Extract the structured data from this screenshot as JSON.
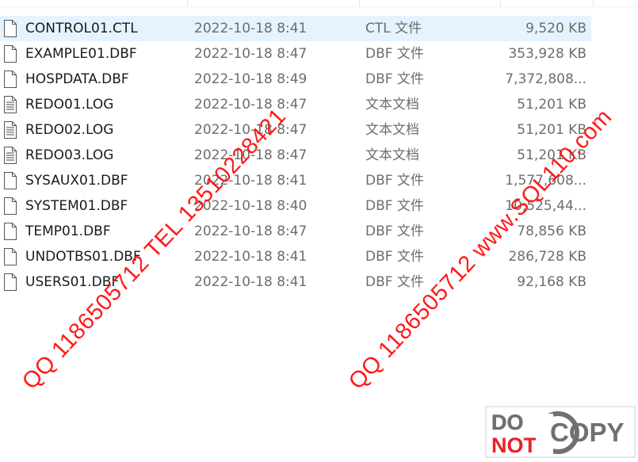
{
  "files": [
    {
      "name": "CONTROL01.CTL",
      "modified": "2022-10-18 8:41",
      "type": "CTL 文件",
      "size": "9,520 KB",
      "icon": "blank-file-icon",
      "selected": true
    },
    {
      "name": "EXAMPLE01.DBF",
      "modified": "2022-10-18 8:47",
      "type": "DBF 文件",
      "size": "353,928 KB",
      "icon": "blank-file-icon"
    },
    {
      "name": "HOSPDATA.DBF",
      "modified": "2022-10-18 8:49",
      "type": "DBF 文件",
      "size": "7,372,808...",
      "icon": "blank-file-icon"
    },
    {
      "name": "REDO01.LOG",
      "modified": "2022-10-18 8:47",
      "type": "文本文档",
      "size": "51,201 KB",
      "icon": "text-file-icon"
    },
    {
      "name": "REDO02.LOG",
      "modified": "2022-10-18 8:47",
      "type": "文本文档",
      "size": "51,201 KB",
      "icon": "text-file-icon"
    },
    {
      "name": "REDO03.LOG",
      "modified": "2022-10-18 8:47",
      "type": "文本文档",
      "size": "51,201 KB",
      "icon": "text-file-icon"
    },
    {
      "name": "SYSAUX01.DBF",
      "modified": "2022-10-18 8:41",
      "type": "DBF 文件",
      "size": "1,577,608...",
      "icon": "blank-file-icon"
    },
    {
      "name": "SYSTEM01.DBF",
      "modified": "2022-10-18 8:40",
      "type": "DBF 文件",
      "size": "10,525,44...",
      "icon": "blank-file-icon"
    },
    {
      "name": "TEMP01.DBF",
      "modified": "2022-10-18 8:47",
      "type": "DBF 文件",
      "size": "78,856 KB",
      "icon": "blank-file-icon"
    },
    {
      "name": "UNDOTBS01.DBF",
      "modified": "2022-10-18 8:41",
      "type": "DBF 文件",
      "size": "286,728 KB",
      "icon": "blank-file-icon"
    },
    {
      "name": "USERS01.DBF",
      "modified": "2022-10-18 8:41",
      "type": "DBF 文件",
      "size": "92,168 KB",
      "icon": "blank-file-icon"
    }
  ],
  "watermarks": {
    "left": "QQ 1186505712 TEL 13510228421",
    "right": "QQ 1186505712 www.SQL110.com"
  },
  "stamp": {
    "line1": "DO",
    "line2": "NOT",
    "word": "COPY"
  },
  "colors": {
    "selection": "#e5f3ff",
    "watermark": "#ff1a1a",
    "stamp_red": "#e8202a",
    "stamp_gray": "#707070"
  }
}
